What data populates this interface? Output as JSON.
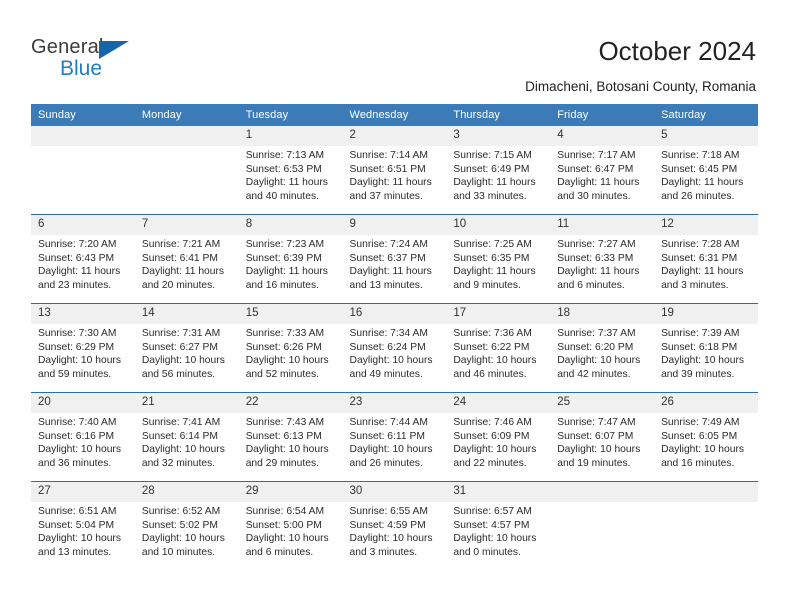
{
  "brand": {
    "name_top": "General",
    "name_bottom": "Blue",
    "triangle_color": "#1565a8",
    "blue_text_color": "#1f7fc4"
  },
  "header": {
    "title": "October 2024",
    "subtitle": "Dimacheni, Botosani County, Romania"
  },
  "theme": {
    "header_row_bg": "#3b7cb8",
    "daynum_bg": "#f0f0f0",
    "week_divider": "#2e6da4"
  },
  "calendar": {
    "weekday_headers": [
      "Sunday",
      "Monday",
      "Tuesday",
      "Wednesday",
      "Thursday",
      "Friday",
      "Saturday"
    ],
    "weeks": [
      [
        {
          "day": "",
          "blank": true,
          "sunrise": "",
          "sunset": "",
          "daylight1": "",
          "daylight2": ""
        },
        {
          "day": "",
          "blank": true,
          "sunrise": "",
          "sunset": "",
          "daylight1": "",
          "daylight2": ""
        },
        {
          "day": "1",
          "sunrise": "Sunrise: 7:13 AM",
          "sunset": "Sunset: 6:53 PM",
          "daylight1": "Daylight: 11 hours",
          "daylight2": "and 40 minutes."
        },
        {
          "day": "2",
          "sunrise": "Sunrise: 7:14 AM",
          "sunset": "Sunset: 6:51 PM",
          "daylight1": "Daylight: 11 hours",
          "daylight2": "and 37 minutes."
        },
        {
          "day": "3",
          "sunrise": "Sunrise: 7:15 AM",
          "sunset": "Sunset: 6:49 PM",
          "daylight1": "Daylight: 11 hours",
          "daylight2": "and 33 minutes."
        },
        {
          "day": "4",
          "sunrise": "Sunrise: 7:17 AM",
          "sunset": "Sunset: 6:47 PM",
          "daylight1": "Daylight: 11 hours",
          "daylight2": "and 30 minutes."
        },
        {
          "day": "5",
          "sunrise": "Sunrise: 7:18 AM",
          "sunset": "Sunset: 6:45 PM",
          "daylight1": "Daylight: 11 hours",
          "daylight2": "and 26 minutes."
        }
      ],
      [
        {
          "day": "6",
          "sunrise": "Sunrise: 7:20 AM",
          "sunset": "Sunset: 6:43 PM",
          "daylight1": "Daylight: 11 hours",
          "daylight2": "and 23 minutes."
        },
        {
          "day": "7",
          "sunrise": "Sunrise: 7:21 AM",
          "sunset": "Sunset: 6:41 PM",
          "daylight1": "Daylight: 11 hours",
          "daylight2": "and 20 minutes."
        },
        {
          "day": "8",
          "sunrise": "Sunrise: 7:23 AM",
          "sunset": "Sunset: 6:39 PM",
          "daylight1": "Daylight: 11 hours",
          "daylight2": "and 16 minutes."
        },
        {
          "day": "9",
          "sunrise": "Sunrise: 7:24 AM",
          "sunset": "Sunset: 6:37 PM",
          "daylight1": "Daylight: 11 hours",
          "daylight2": "and 13 minutes."
        },
        {
          "day": "10",
          "sunrise": "Sunrise: 7:25 AM",
          "sunset": "Sunset: 6:35 PM",
          "daylight1": "Daylight: 11 hours",
          "daylight2": "and 9 minutes."
        },
        {
          "day": "11",
          "sunrise": "Sunrise: 7:27 AM",
          "sunset": "Sunset: 6:33 PM",
          "daylight1": "Daylight: 11 hours",
          "daylight2": "and 6 minutes."
        },
        {
          "day": "12",
          "sunrise": "Sunrise: 7:28 AM",
          "sunset": "Sunset: 6:31 PM",
          "daylight1": "Daylight: 11 hours",
          "daylight2": "and 3 minutes."
        }
      ],
      [
        {
          "day": "13",
          "sunrise": "Sunrise: 7:30 AM",
          "sunset": "Sunset: 6:29 PM",
          "daylight1": "Daylight: 10 hours",
          "daylight2": "and 59 minutes."
        },
        {
          "day": "14",
          "sunrise": "Sunrise: 7:31 AM",
          "sunset": "Sunset: 6:27 PM",
          "daylight1": "Daylight: 10 hours",
          "daylight2": "and 56 minutes."
        },
        {
          "day": "15",
          "sunrise": "Sunrise: 7:33 AM",
          "sunset": "Sunset: 6:26 PM",
          "daylight1": "Daylight: 10 hours",
          "daylight2": "and 52 minutes."
        },
        {
          "day": "16",
          "sunrise": "Sunrise: 7:34 AM",
          "sunset": "Sunset: 6:24 PM",
          "daylight1": "Daylight: 10 hours",
          "daylight2": "and 49 minutes."
        },
        {
          "day": "17",
          "sunrise": "Sunrise: 7:36 AM",
          "sunset": "Sunset: 6:22 PM",
          "daylight1": "Daylight: 10 hours",
          "daylight2": "and 46 minutes."
        },
        {
          "day": "18",
          "sunrise": "Sunrise: 7:37 AM",
          "sunset": "Sunset: 6:20 PM",
          "daylight1": "Daylight: 10 hours",
          "daylight2": "and 42 minutes."
        },
        {
          "day": "19",
          "sunrise": "Sunrise: 7:39 AM",
          "sunset": "Sunset: 6:18 PM",
          "daylight1": "Daylight: 10 hours",
          "daylight2": "and 39 minutes."
        }
      ],
      [
        {
          "day": "20",
          "sunrise": "Sunrise: 7:40 AM",
          "sunset": "Sunset: 6:16 PM",
          "daylight1": "Daylight: 10 hours",
          "daylight2": "and 36 minutes."
        },
        {
          "day": "21",
          "sunrise": "Sunrise: 7:41 AM",
          "sunset": "Sunset: 6:14 PM",
          "daylight1": "Daylight: 10 hours",
          "daylight2": "and 32 minutes."
        },
        {
          "day": "22",
          "sunrise": "Sunrise: 7:43 AM",
          "sunset": "Sunset: 6:13 PM",
          "daylight1": "Daylight: 10 hours",
          "daylight2": "and 29 minutes."
        },
        {
          "day": "23",
          "sunrise": "Sunrise: 7:44 AM",
          "sunset": "Sunset: 6:11 PM",
          "daylight1": "Daylight: 10 hours",
          "daylight2": "and 26 minutes."
        },
        {
          "day": "24",
          "sunrise": "Sunrise: 7:46 AM",
          "sunset": "Sunset: 6:09 PM",
          "daylight1": "Daylight: 10 hours",
          "daylight2": "and 22 minutes."
        },
        {
          "day": "25",
          "sunrise": "Sunrise: 7:47 AM",
          "sunset": "Sunset: 6:07 PM",
          "daylight1": "Daylight: 10 hours",
          "daylight2": "and 19 minutes."
        },
        {
          "day": "26",
          "sunrise": "Sunrise: 7:49 AM",
          "sunset": "Sunset: 6:05 PM",
          "daylight1": "Daylight: 10 hours",
          "daylight2": "and 16 minutes."
        }
      ],
      [
        {
          "day": "27",
          "sunrise": "Sunrise: 6:51 AM",
          "sunset": "Sunset: 5:04 PM",
          "daylight1": "Daylight: 10 hours",
          "daylight2": "and 13 minutes."
        },
        {
          "day": "28",
          "sunrise": "Sunrise: 6:52 AM",
          "sunset": "Sunset: 5:02 PM",
          "daylight1": "Daylight: 10 hours",
          "daylight2": "and 10 minutes."
        },
        {
          "day": "29",
          "sunrise": "Sunrise: 6:54 AM",
          "sunset": "Sunset: 5:00 PM",
          "daylight1": "Daylight: 10 hours",
          "daylight2": "and 6 minutes."
        },
        {
          "day": "30",
          "sunrise": "Sunrise: 6:55 AM",
          "sunset": "Sunset: 4:59 PM",
          "daylight1": "Daylight: 10 hours",
          "daylight2": "and 3 minutes."
        },
        {
          "day": "31",
          "sunrise": "Sunrise: 6:57 AM",
          "sunset": "Sunset: 4:57 PM",
          "daylight1": "Daylight: 10 hours",
          "daylight2": "and 0 minutes."
        },
        {
          "day": "",
          "blank": true,
          "sunrise": "",
          "sunset": "",
          "daylight1": "",
          "daylight2": ""
        },
        {
          "day": "",
          "blank": true,
          "sunrise": "",
          "sunset": "",
          "daylight1": "",
          "daylight2": ""
        }
      ]
    ]
  }
}
